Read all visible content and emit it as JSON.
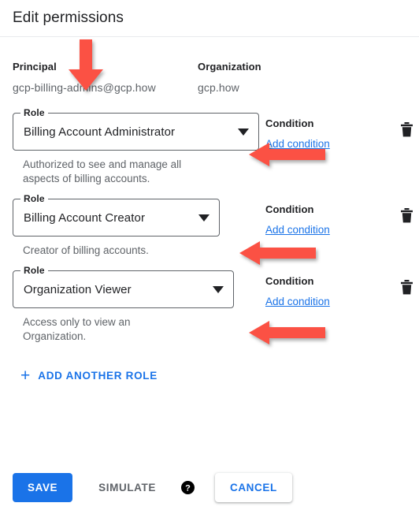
{
  "header": {
    "title": "Edit permissions"
  },
  "meta": {
    "principal_label": "Principal",
    "principal_value": "gcp-billing-admins@gcp.how",
    "organization_label": "Organization",
    "organization_value": "gcp.how"
  },
  "roles": [
    {
      "field_label": "Role",
      "value": "Billing Account Administrator",
      "description": "Authorized to see and manage all aspects of billing accounts.",
      "condition_label": "Condition",
      "condition_link": "Add condition",
      "delete_icon": "trash-icon",
      "dropdown_icon": "chevron-down-icon",
      "select_width": 313
    },
    {
      "field_label": "Role",
      "value": "Billing Account Creator",
      "description": "Creator of billing accounts.",
      "condition_label": "Condition",
      "condition_link": "Add condition",
      "delete_icon": "trash-icon",
      "dropdown_icon": "chevron-down-icon",
      "select_width": 263
    },
    {
      "field_label": "Role",
      "value": "Organization Viewer",
      "description": "Access only to view an Organization.",
      "condition_label": "Condition",
      "condition_link": "Add condition",
      "delete_icon": "trash-icon",
      "dropdown_icon": "chevron-down-icon",
      "select_width": 281
    }
  ],
  "add_role": {
    "label": "ADD ANOTHER ROLE",
    "icon": "plus-icon"
  },
  "footer": {
    "save_label": "SAVE",
    "simulate_label": "SIMULATE",
    "help_icon": "help-circle-icon",
    "cancel_label": "CANCEL"
  },
  "colors": {
    "accent_blue": "#1a73e8",
    "text_primary": "#202124",
    "text_secondary": "#5f6368",
    "annotation_red": "#fb5144",
    "divider": "#e8eaed"
  },
  "annotations": [
    {
      "name": "arrow-principal",
      "direction": "down"
    },
    {
      "name": "arrow-condition-1",
      "direction": "left"
    },
    {
      "name": "arrow-condition-2",
      "direction": "left"
    },
    {
      "name": "arrow-condition-3",
      "direction": "left"
    }
  ]
}
